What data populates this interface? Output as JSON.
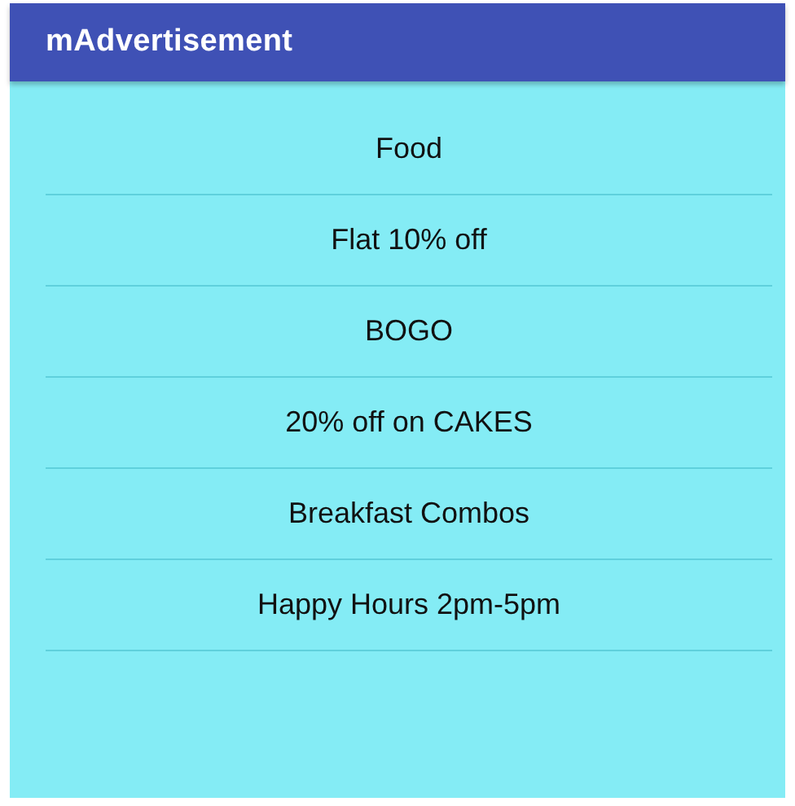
{
  "app_bar": {
    "title": "mAdvertisement"
  },
  "list": {
    "items": [
      {
        "label": "Food"
      },
      {
        "label": "Flat 10% off"
      },
      {
        "label": "BOGO"
      },
      {
        "label": "20% off on CAKES"
      },
      {
        "label": "Breakfast Combos"
      },
      {
        "label": "Happy Hours 2pm-5pm"
      }
    ]
  }
}
